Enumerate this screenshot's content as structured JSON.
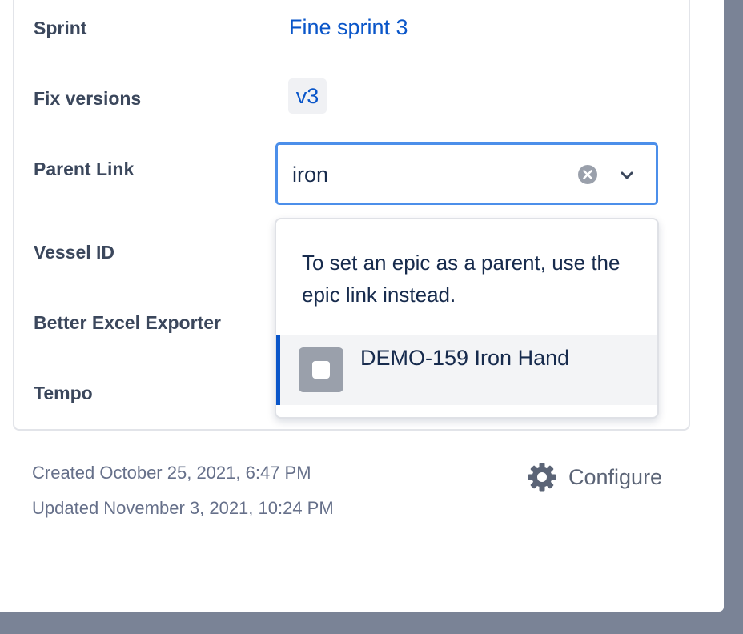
{
  "fields": {
    "sprint": {
      "label": "Sprint",
      "value": "Fine sprint 3"
    },
    "fix_versions": {
      "label": "Fix versions",
      "value": "v3"
    },
    "parent_link": {
      "label": "Parent Link",
      "value": "iron"
    },
    "vessel_id": {
      "label": "Vessel ID"
    },
    "better_excel": {
      "label": "Better Excel Exporter"
    },
    "tempo": {
      "label": "Tempo"
    }
  },
  "dropdown": {
    "hint": "To set an epic as a parent, use the epic link instead.",
    "options": [
      {
        "label": "DEMO-159 Iron Hand",
        "icon": "issue-type-icon"
      }
    ]
  },
  "meta": {
    "created": "Created October 25, 2021, 6:47 PM",
    "updated": "Updated November 3, 2021, 10:24 PM"
  },
  "configure": {
    "label": "Configure",
    "icon": "gear-icon"
  },
  "colors": {
    "link": "#0a56c9",
    "focus": "#4c8fea",
    "backdrop": "#7a8396"
  }
}
